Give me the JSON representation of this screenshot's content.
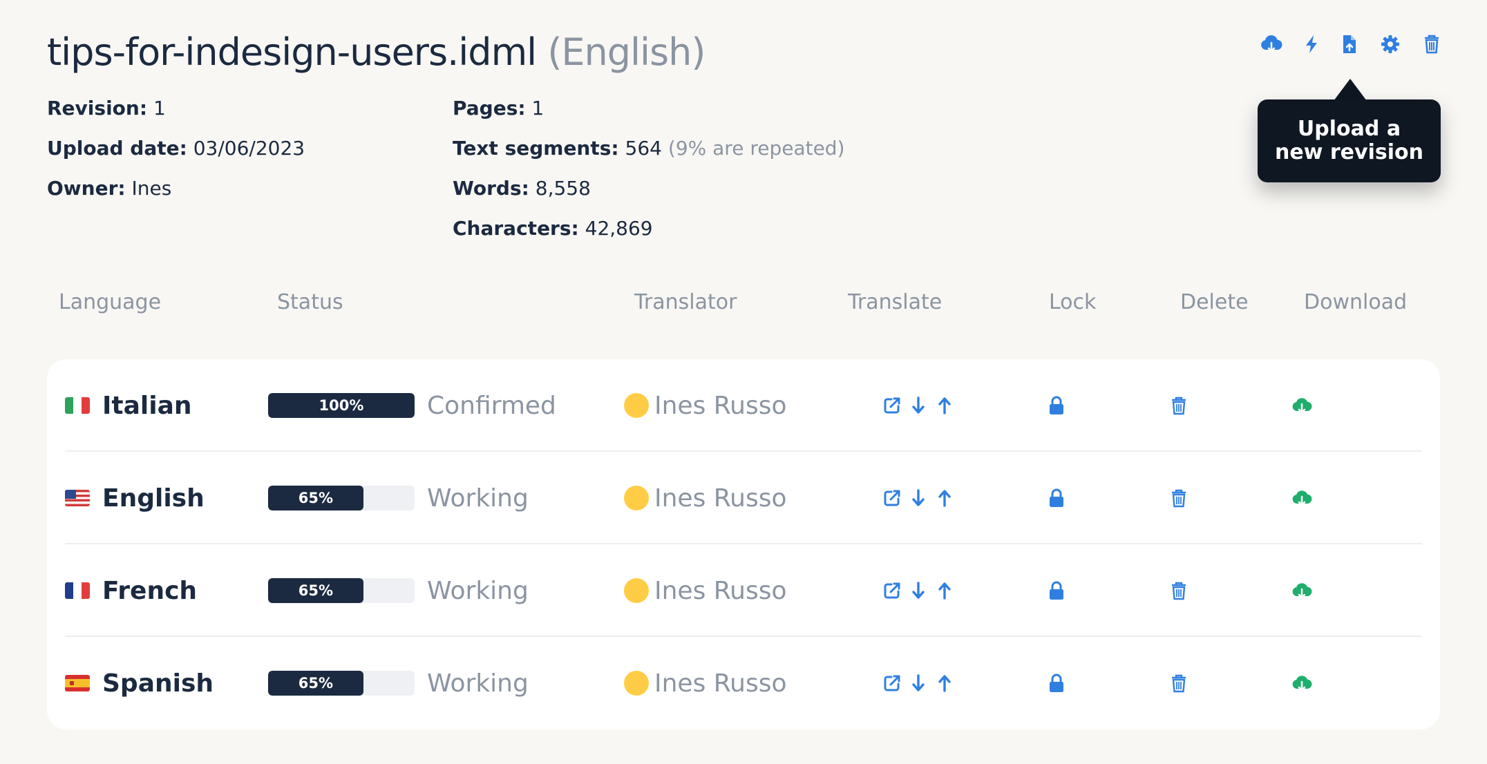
{
  "file": {
    "name": "tips-for-indesign-users.idml",
    "language": "(English)"
  },
  "meta_left": [
    {
      "label": "Revision:",
      "value": "1"
    },
    {
      "label": "Upload date:",
      "value": "03/06/2023"
    },
    {
      "label": "Owner:",
      "value": "Ines"
    }
  ],
  "meta_right": [
    {
      "label": "Pages:",
      "value": "1",
      "note": ""
    },
    {
      "label": "Text segments:",
      "value": "564",
      "note": "(9% are repeated)"
    },
    {
      "label": "Words:",
      "value": "8,558",
      "note": ""
    },
    {
      "label": "Characters:",
      "value": "42,869",
      "note": ""
    }
  ],
  "tooltip": {
    "text": "Upload a new revision"
  },
  "toolbar_icons": [
    "cloud-download-icon",
    "lightning-icon",
    "file-upload-icon",
    "gear-icon",
    "trash-icon"
  ],
  "columns": [
    "Language",
    "Status",
    "Translator",
    "Translate",
    "Lock",
    "Delete",
    "Download"
  ],
  "colors": {
    "accent_blue": "#2f7fe0",
    "download_green": "#1fae6b",
    "dark": "#1b2a40",
    "muted": "#8b94a1",
    "avatar": "#ffcd45"
  },
  "rows": [
    {
      "language": "Italian",
      "flag": "italy-flag-icon",
      "progress": 100,
      "progress_label": "100%",
      "status": "Confirmed",
      "translator": "Ines Russo"
    },
    {
      "language": "English",
      "flag": "us-flag-icon",
      "progress": 65,
      "progress_label": "65%",
      "status": "Working",
      "translator": "Ines Russo"
    },
    {
      "language": "French",
      "flag": "france-flag-icon",
      "progress": 65,
      "progress_label": "65%",
      "status": "Working",
      "translator": "Ines Russo"
    },
    {
      "language": "Spanish",
      "flag": "spain-flag-icon",
      "progress": 65,
      "progress_label": "65%",
      "status": "Working",
      "translator": "Ines Russo"
    }
  ]
}
